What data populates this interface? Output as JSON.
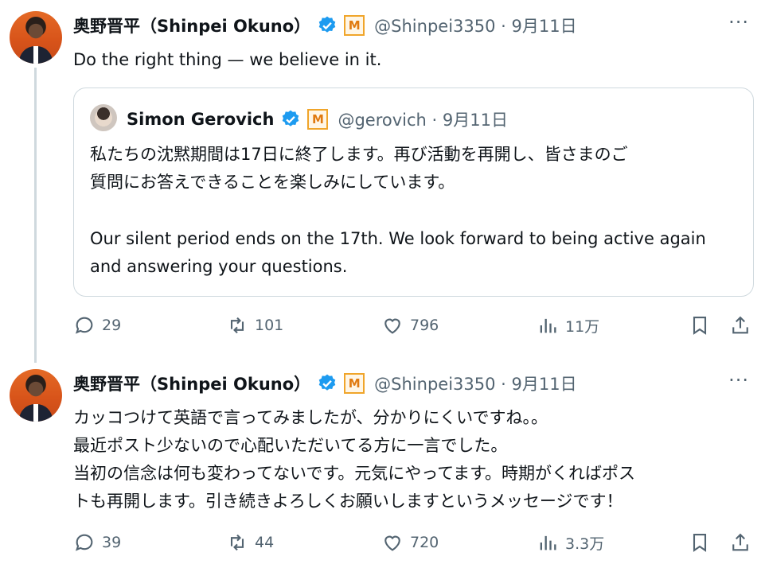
{
  "tweets": [
    {
      "author_name": "奥野晋平（Shinpei Okuno）",
      "handle_date": "@Shinpei3350 · 9月11日",
      "text": "Do the right thing — we believe in it.",
      "quote": {
        "author_name": "Simon Gerovich",
        "handle_date": "@gerovich · 9月11日",
        "lines": [
          "私たちの沈黙期間は17日に終了します。再び活動を再開し、皆さまのご",
          "質問にお答えできることを楽しみにしています。",
          "Our silent period ends on the 17th. We look forward to being active again",
          "and answering your questions."
        ]
      },
      "replies": "29",
      "reposts": "101",
      "likes": "796",
      "views": "11万"
    },
    {
      "author_name": "奥野晋平（Shinpei Okuno）",
      "handle_date": "@Shinpei3350 · 9月11日",
      "lines": [
        "カッコつけて英語で言ってみましたが、分かりにくいですね。。",
        "最近ポスト少ないので心配いただいてる方に一言でした。",
        "当初の信念は何も変わってないです。元気にやってます。時期がくればポス",
        "トも再開します。引き続きよろしくお願いしますというメッセージです！"
      ],
      "replies": "39",
      "reposts": "44",
      "likes": "720",
      "views": "3.3万"
    }
  ],
  "badge_letter": "M",
  "more_glyph": "···",
  "colors": {
    "verified": "#1d9bf0",
    "muted": "#536471",
    "border": "#cfd9de",
    "badge": "#f0a52a"
  },
  "icons": [
    "verified-icon",
    "business-badge-icon",
    "more-icon",
    "reply-icon",
    "repost-icon",
    "like-icon",
    "views-icon",
    "bookmark-icon",
    "share-icon"
  ]
}
